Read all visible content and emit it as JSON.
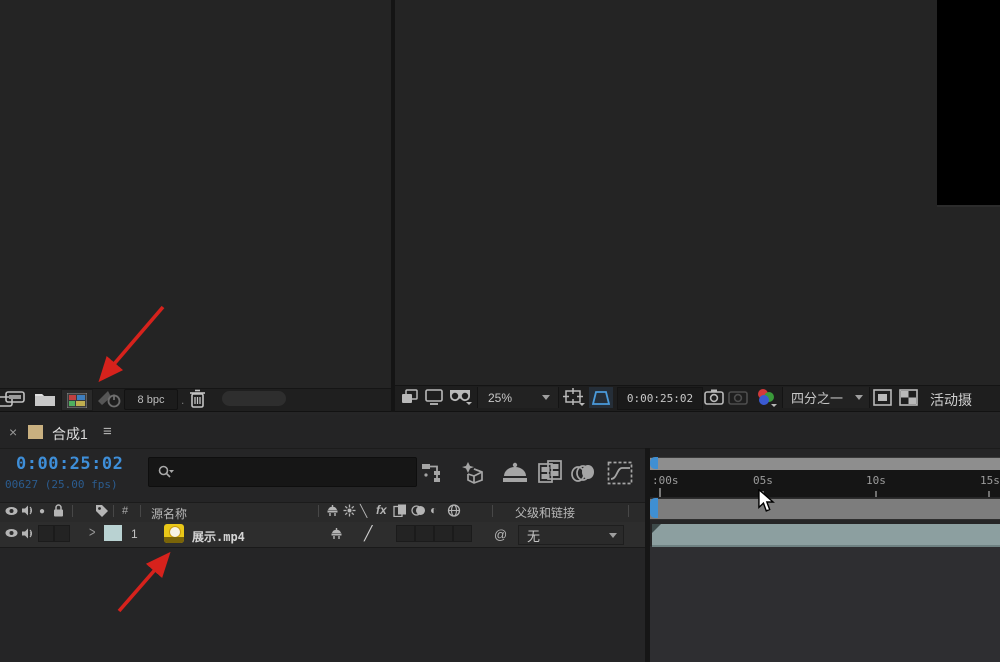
{
  "colors": {
    "accent_blue": "#3f8fd2",
    "timecode_blue": "#3e8ed8",
    "dim_blue": "#2b5c8f",
    "arrow_red": "#d6221c",
    "layer_bar": "#8c9fa0",
    "label_swatch": "#b9d2d2",
    "media_yellow": "#e9c718",
    "comp_tan": "#c9b080"
  },
  "icons": {
    "close": "×",
    "menu": "≡",
    "solo_dot": "●",
    "quality_back": "╲",
    "quality_fwd": "╱",
    "fx": "fx",
    "adjustment": "◐",
    "pickwhip": "@",
    "expand": ">",
    "dot": "."
  },
  "project_panel": {
    "color_depth": "8 bpc"
  },
  "viewer_panel": {
    "zoom_level": "25%",
    "timecode": "0:00:25:02",
    "resolution": "四分之一",
    "camera_label": "活动摄"
  },
  "timeline_panel": {
    "tab": {
      "title": "合成1"
    },
    "timecode": "0:00:25:02",
    "frame_info": "00627 (25.00 fps)",
    "columns": {
      "index": "#",
      "source_name": "源名称",
      "parent_link": "父级和链接"
    },
    "layer": {
      "number": "1",
      "name": "展示.mp4",
      "parent": "无"
    },
    "ruler": {
      "ticks": [
        ":00s",
        "05s",
        "10s",
        "15s"
      ]
    }
  }
}
